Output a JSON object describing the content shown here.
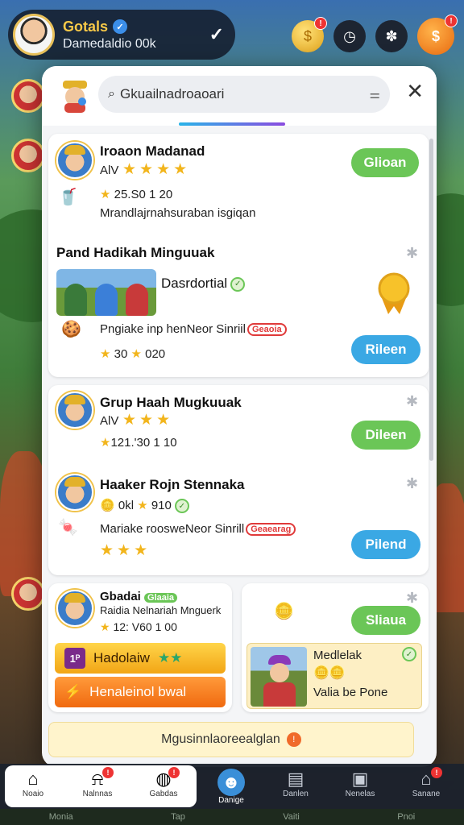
{
  "topbar": {
    "username": "Gotals",
    "subtitle": "Damedaldio 00k"
  },
  "search": {
    "value": "",
    "placeholder": "Gkuailnadroaoari"
  },
  "cards": {
    "c1": {
      "title": "Iroaon Madanad",
      "level": "AlV",
      "stats": "25.S0 1 20",
      "desc": "Mrandlajrnahsuraban isgiqan",
      "button": "Glioan"
    },
    "section_title": "Pand Hadikah Minguuak",
    "c2": {
      "title": "Dasrdortial",
      "desc": "Pngiake inp henNeor Sinriil",
      "badge": "Geaoia",
      "stats": "30",
      "stats2": "020",
      "button": "Rileen"
    },
    "c3": {
      "title": "Grup Haah Mugkuuak",
      "level": "AlV",
      "stats": "121.'30 1 10",
      "button": "Dileen"
    },
    "c4": {
      "title": "Haaker Rojn Stennaka",
      "stats": "0kl",
      "stats2": "910",
      "desc": "Mariake roosweNeor Sinrill",
      "badge": "Geaearag",
      "button": "Pilend"
    },
    "c5": {
      "title": "Gbadai",
      "tag": "Glaaia",
      "subtitle": "Raidia Nelnariah Mnguerk",
      "stats": "12: V60 1 00",
      "orange1": "Hadolaiw",
      "orange2": "Henaleinol bwal"
    },
    "c6": {
      "button": "Sliaua",
      "title": "Medlelak",
      "subtitle": "Valia be Pone"
    }
  },
  "promo": {
    "text": "Mgusinnlaoreealglan"
  },
  "nav": [
    {
      "label": "Noaio"
    },
    {
      "label": "Nalnnas"
    },
    {
      "label": "Gabdas"
    },
    {
      "label": "Danige"
    },
    {
      "label": "Danlen"
    },
    {
      "label": "Nenelas"
    },
    {
      "label": "Sanane"
    }
  ],
  "footer": {
    "left": "Monia",
    "mid": "Tap",
    "right1": "Vaiti",
    "right2": "Pnoi"
  },
  "colors": {
    "green_button": "#6bc657",
    "blue_button": "#3aa8e4",
    "star": "#f2b51c",
    "accent_tab": "#8a4be0"
  }
}
